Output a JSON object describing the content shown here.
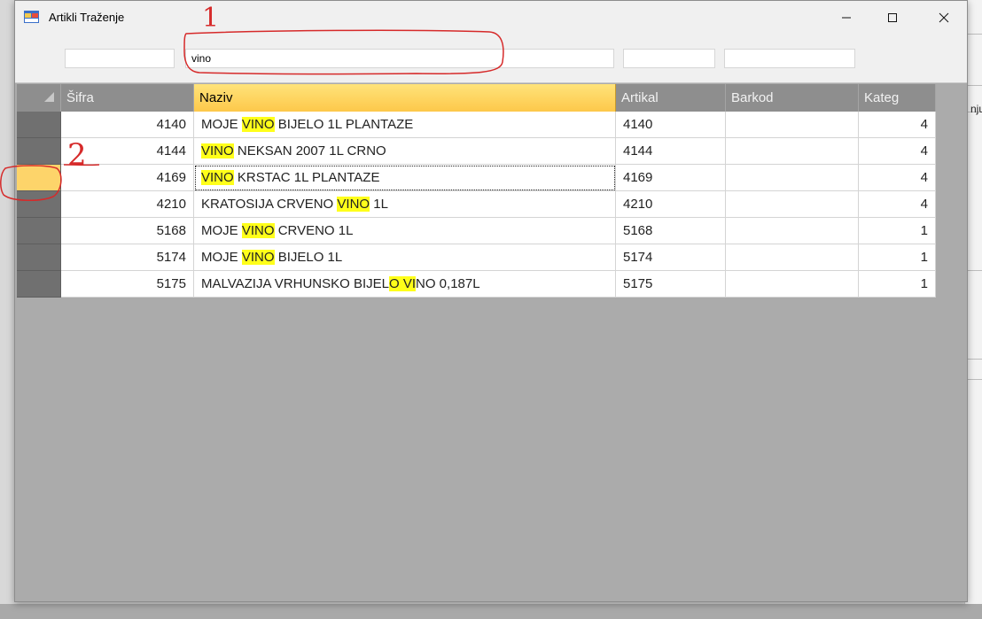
{
  "window": {
    "title": "Artikli Traženje"
  },
  "filters": {
    "sifra": "",
    "naziv": "vino",
    "artikal": "",
    "barkod": ""
  },
  "background_app": {
    "clip_text": "nju"
  },
  "grid": {
    "columns": [
      "Šifra",
      "Naziv",
      "Artikal",
      "Barkod",
      "Kateg"
    ],
    "selected_column": "Naziv",
    "current_row": 2,
    "rows": [
      {
        "sifra": "4140",
        "naziv_pre": "MOJE ",
        "naziv_hl": "VINO",
        "naziv_post": " BIJELO 1L PLANTAZE",
        "artikal": "4140",
        "barkod": "",
        "kateg": "4"
      },
      {
        "sifra": "4144",
        "naziv_pre": "",
        "naziv_hl": "VINO",
        "naziv_post": " NEKSAN 2007 1L CRNO",
        "artikal": "4144",
        "barkod": "",
        "kateg": "4"
      },
      {
        "sifra": "4169",
        "naziv_pre": "",
        "naziv_hl": "VINO",
        "naziv_post": " KRSTAC 1L PLANTAZE",
        "artikal": "4169",
        "barkod": "",
        "kateg": "4"
      },
      {
        "sifra": "4210",
        "naziv_pre": "KRATOSIJA CRVENO ",
        "naziv_hl": "VINO",
        "naziv_post": " 1L",
        "artikal": "4210",
        "barkod": "",
        "kateg": "4"
      },
      {
        "sifra": "5168",
        "naziv_pre": "MOJE ",
        "naziv_hl": "VINO",
        "naziv_post": " CRVENO 1L",
        "artikal": "5168",
        "barkod": "",
        "kateg": "1"
      },
      {
        "sifra": "5174",
        "naziv_pre": "MOJE ",
        "naziv_hl": "VINO",
        "naziv_post": " BIJELO 1L",
        "artikal": "5174",
        "barkod": "",
        "kateg": "1"
      },
      {
        "sifra": "5175",
        "naziv_pre": "MALVAZIJA VRHUNSKO BIJEL",
        "naziv_hl": "O VI",
        "naziv_post": "NO 0,187L",
        "artikal": "5175",
        "barkod": "",
        "kateg": "1"
      }
    ]
  },
  "annotations": {
    "label_1": "1",
    "label_2": "2",
    "color": "#d62a2a"
  },
  "colors": {
    "highlight": "#ffff1a",
    "selected_header": "#fdc84a",
    "header_bg": "#8e8e8e",
    "row_header": "#707070",
    "grid_bg": "#ababab"
  },
  "icons": {
    "app": "app-icon",
    "minimize": "minimize-icon",
    "maximize": "maximize-icon",
    "close": "close-icon",
    "corner": "select-all-triangle-icon"
  }
}
